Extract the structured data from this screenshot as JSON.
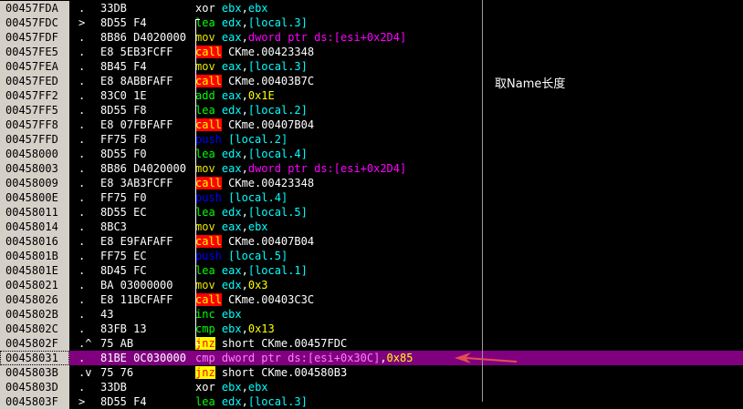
{
  "rows": [
    {
      "addr": "00457FDA",
      "mark": ".",
      "hex": "33DB",
      "asm": [
        {
          "t": "xor",
          "c": "op"
        },
        {
          "t": " "
        },
        {
          "t": "ebx",
          "c": "reg"
        },
        {
          "t": ","
        },
        {
          "t": "ebx",
          "c": "reg"
        }
      ]
    },
    {
      "addr": "00457FDC",
      "mark": ">",
      "hex": "8D55 F4",
      "asm": [
        {
          "t": "lea",
          "c": "m-lime"
        },
        {
          "t": " "
        },
        {
          "t": "edx",
          "c": "reg"
        },
        {
          "t": ","
        },
        {
          "t": "[local.3]",
          "c": "reg"
        }
      ]
    },
    {
      "addr": "00457FDF",
      "mark": ".",
      "hex": "8B86 D4020000",
      "asm": [
        {
          "t": "mov",
          "c": "m-yellow"
        },
        {
          "t": " "
        },
        {
          "t": "eax",
          "c": "reg"
        },
        {
          "t": ","
        },
        {
          "t": "dword ptr ds:[esi+0x2D4]",
          "c": "kw"
        }
      ]
    },
    {
      "addr": "00457FE5",
      "mark": ".",
      "hex": "E8 5EB3FCFF",
      "asm": [
        {
          "t": "call",
          "c": "m-call"
        },
        {
          "t": " CKme.00423348"
        }
      ]
    },
    {
      "addr": "00457FEA",
      "mark": ".",
      "hex": "8B45 F4",
      "asm": [
        {
          "t": "mov",
          "c": "m-yellow"
        },
        {
          "t": " "
        },
        {
          "t": "eax",
          "c": "reg"
        },
        {
          "t": ","
        },
        {
          "t": "[local.3]",
          "c": "reg"
        }
      ]
    },
    {
      "addr": "00457FED",
      "mark": ".",
      "hex": "E8 8ABBFAFF",
      "asm": [
        {
          "t": "call",
          "c": "m-call"
        },
        {
          "t": " CKme.00403B7C"
        }
      ]
    },
    {
      "addr": "00457FF2",
      "mark": ".",
      "hex": "83C0 1E",
      "asm": [
        {
          "t": "add",
          "c": "m-lime"
        },
        {
          "t": " "
        },
        {
          "t": "eax",
          "c": "reg"
        },
        {
          "t": ","
        },
        {
          "t": "0x1E",
          "c": "num"
        }
      ]
    },
    {
      "addr": "00457FF5",
      "mark": ".",
      "hex": "8D55 F8",
      "asm": [
        {
          "t": "lea",
          "c": "m-lime"
        },
        {
          "t": " "
        },
        {
          "t": "edx",
          "c": "reg"
        },
        {
          "t": ","
        },
        {
          "t": "[local.2]",
          "c": "reg"
        }
      ]
    },
    {
      "addr": "00457FF8",
      "mark": ".",
      "hex": "E8 07FBFAFF",
      "asm": [
        {
          "t": "call",
          "c": "m-call"
        },
        {
          "t": " CKme.00407B04"
        }
      ]
    },
    {
      "addr": "00457FFD",
      "mark": ".",
      "hex": "FF75 F8",
      "asm": [
        {
          "t": "push",
          "c": "m-push"
        },
        {
          "t": " "
        },
        {
          "t": "[local.2]",
          "c": "reg"
        }
      ]
    },
    {
      "addr": "00458000",
      "mark": ".",
      "hex": "8D55 F0",
      "asm": [
        {
          "t": "lea",
          "c": "m-lime"
        },
        {
          "t": " "
        },
        {
          "t": "edx",
          "c": "reg"
        },
        {
          "t": ","
        },
        {
          "t": "[local.4]",
          "c": "reg"
        }
      ]
    },
    {
      "addr": "00458003",
      "mark": ".",
      "hex": "8B86 D4020000",
      "asm": [
        {
          "t": "mov",
          "c": "m-yellow"
        },
        {
          "t": " "
        },
        {
          "t": "eax",
          "c": "reg"
        },
        {
          "t": ","
        },
        {
          "t": "dword ptr ds:[esi+0x2D4]",
          "c": "kw"
        }
      ]
    },
    {
      "addr": "00458009",
      "mark": ".",
      "hex": "E8 3AB3FCFF",
      "asm": [
        {
          "t": "call",
          "c": "m-call"
        },
        {
          "t": " CKme.00423348"
        }
      ]
    },
    {
      "addr": "0045800E",
      "mark": ".",
      "hex": "FF75 F0",
      "asm": [
        {
          "t": "push",
          "c": "m-push"
        },
        {
          "t": " "
        },
        {
          "t": "[local.4]",
          "c": "reg"
        }
      ]
    },
    {
      "addr": "00458011",
      "mark": ".",
      "hex": "8D55 EC",
      "asm": [
        {
          "t": "lea",
          "c": "m-lime"
        },
        {
          "t": " "
        },
        {
          "t": "edx",
          "c": "reg"
        },
        {
          "t": ","
        },
        {
          "t": "[local.5]",
          "c": "reg"
        }
      ]
    },
    {
      "addr": "00458014",
      "mark": ".",
      "hex": "8BC3",
      "asm": [
        {
          "t": "mov",
          "c": "m-yellow"
        },
        {
          "t": " "
        },
        {
          "t": "eax",
          "c": "reg"
        },
        {
          "t": ","
        },
        {
          "t": "ebx",
          "c": "reg"
        }
      ]
    },
    {
      "addr": "00458016",
      "mark": ".",
      "hex": "E8 E9FAFAFF",
      "asm": [
        {
          "t": "call",
          "c": "m-call"
        },
        {
          "t": " CKme.00407B04"
        }
      ]
    },
    {
      "addr": "0045801B",
      "mark": ".",
      "hex": "FF75 EC",
      "asm": [
        {
          "t": "push",
          "c": "m-push"
        },
        {
          "t": " "
        },
        {
          "t": "[local.5]",
          "c": "reg"
        }
      ]
    },
    {
      "addr": "0045801E",
      "mark": ".",
      "hex": "8D45 FC",
      "asm": [
        {
          "t": "lea",
          "c": "m-lime"
        },
        {
          "t": " "
        },
        {
          "t": "eax",
          "c": "reg"
        },
        {
          "t": ","
        },
        {
          "t": "[local.1]",
          "c": "reg"
        }
      ]
    },
    {
      "addr": "00458021",
      "mark": ".",
      "hex": "BA 03000000",
      "asm": [
        {
          "t": "mov",
          "c": "m-yellow"
        },
        {
          "t": " "
        },
        {
          "t": "edx",
          "c": "reg"
        },
        {
          "t": ","
        },
        {
          "t": "0x3",
          "c": "num"
        }
      ]
    },
    {
      "addr": "00458026",
      "mark": ".",
      "hex": "E8 11BCFAFF",
      "asm": [
        {
          "t": "call",
          "c": "m-call"
        },
        {
          "t": " CKme.00403C3C"
        }
      ]
    },
    {
      "addr": "0045802B",
      "mark": ".",
      "hex": "43",
      "asm": [
        {
          "t": "inc",
          "c": "m-lime"
        },
        {
          "t": " "
        },
        {
          "t": "ebx",
          "c": "reg"
        }
      ]
    },
    {
      "addr": "0045802C",
      "mark": ".",
      "hex": "83FB 13",
      "asm": [
        {
          "t": "cmp",
          "c": "m-lime"
        },
        {
          "t": " "
        },
        {
          "t": "ebx",
          "c": "reg"
        },
        {
          "t": ","
        },
        {
          "t": "0x13",
          "c": "num"
        }
      ]
    },
    {
      "addr": "0045802F",
      "mark": ".^",
      "hex": "75 AB",
      "asm": [
        {
          "t": "jnz",
          "c": "m-jmp"
        },
        {
          "t": " short CKme.00457FDC"
        }
      ]
    },
    {
      "addr": "00458031",
      "mark": ".",
      "hex": "81BE 0C030000",
      "sel": true,
      "asm": [
        {
          "t": "cmp",
          "c": "op"
        },
        {
          "t": " "
        },
        {
          "t": "dword ptr ds:[esi+0x30C]",
          "c": "kw"
        },
        {
          "t": ","
        },
        {
          "t": "0x85",
          "c": "num"
        }
      ]
    },
    {
      "addr": "0045803B",
      "mark": ".v",
      "hex": "75 76",
      "asm": [
        {
          "t": "jnz",
          "c": "m-jmp"
        },
        {
          "t": " short CKme.004580B3"
        }
      ]
    },
    {
      "addr": "0045803D",
      "mark": ".",
      "hex": "33DB",
      "asm": [
        {
          "t": "xor",
          "c": "op"
        },
        {
          "t": " "
        },
        {
          "t": "ebx",
          "c": "reg"
        },
        {
          "t": ","
        },
        {
          "t": "ebx",
          "c": "reg"
        }
      ]
    },
    {
      "addr": "0045803F",
      "mark": ">",
      "hex": "8D55 F4",
      "asm": [
        {
          "t": "lea",
          "c": "m-lime"
        },
        {
          "t": " "
        },
        {
          "t": "edx",
          "c": "reg"
        },
        {
          "t": ","
        },
        {
          "t": "[local.3]",
          "c": "reg"
        }
      ]
    }
  ],
  "comment": "取Name长度",
  "colors": {
    "selection": "#800080",
    "arrow": "#e05050",
    "address_bg": "#d4d0c8"
  }
}
